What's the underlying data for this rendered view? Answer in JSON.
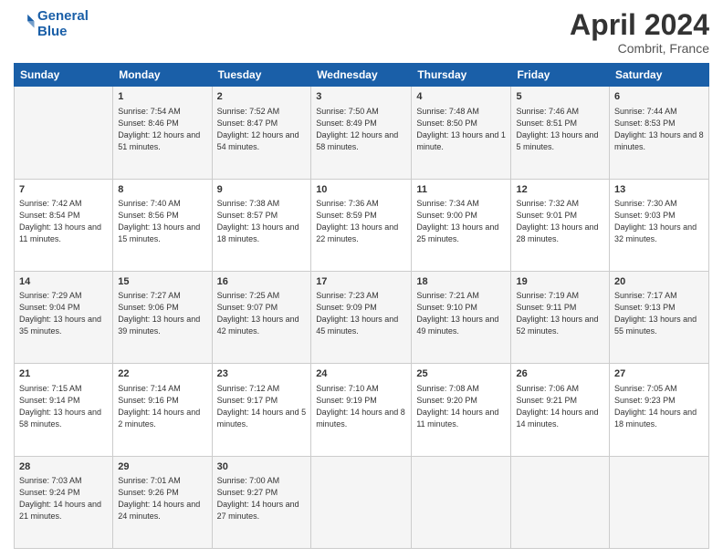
{
  "header": {
    "logo_line1": "General",
    "logo_line2": "Blue",
    "month": "April 2024",
    "location": "Combrit, France"
  },
  "days_of_week": [
    "Sunday",
    "Monday",
    "Tuesday",
    "Wednesday",
    "Thursday",
    "Friday",
    "Saturday"
  ],
  "weeks": [
    [
      {
        "day": "",
        "sunrise": "",
        "sunset": "",
        "daylight": ""
      },
      {
        "day": "1",
        "sunrise": "Sunrise: 7:54 AM",
        "sunset": "Sunset: 8:46 PM",
        "daylight": "Daylight: 12 hours and 51 minutes."
      },
      {
        "day": "2",
        "sunrise": "Sunrise: 7:52 AM",
        "sunset": "Sunset: 8:47 PM",
        "daylight": "Daylight: 12 hours and 54 minutes."
      },
      {
        "day": "3",
        "sunrise": "Sunrise: 7:50 AM",
        "sunset": "Sunset: 8:49 PM",
        "daylight": "Daylight: 12 hours and 58 minutes."
      },
      {
        "day": "4",
        "sunrise": "Sunrise: 7:48 AM",
        "sunset": "Sunset: 8:50 PM",
        "daylight": "Daylight: 13 hours and 1 minute."
      },
      {
        "day": "5",
        "sunrise": "Sunrise: 7:46 AM",
        "sunset": "Sunset: 8:51 PM",
        "daylight": "Daylight: 13 hours and 5 minutes."
      },
      {
        "day": "6",
        "sunrise": "Sunrise: 7:44 AM",
        "sunset": "Sunset: 8:53 PM",
        "daylight": "Daylight: 13 hours and 8 minutes."
      }
    ],
    [
      {
        "day": "7",
        "sunrise": "Sunrise: 7:42 AM",
        "sunset": "Sunset: 8:54 PM",
        "daylight": "Daylight: 13 hours and 11 minutes."
      },
      {
        "day": "8",
        "sunrise": "Sunrise: 7:40 AM",
        "sunset": "Sunset: 8:56 PM",
        "daylight": "Daylight: 13 hours and 15 minutes."
      },
      {
        "day": "9",
        "sunrise": "Sunrise: 7:38 AM",
        "sunset": "Sunset: 8:57 PM",
        "daylight": "Daylight: 13 hours and 18 minutes."
      },
      {
        "day": "10",
        "sunrise": "Sunrise: 7:36 AM",
        "sunset": "Sunset: 8:59 PM",
        "daylight": "Daylight: 13 hours and 22 minutes."
      },
      {
        "day": "11",
        "sunrise": "Sunrise: 7:34 AM",
        "sunset": "Sunset: 9:00 PM",
        "daylight": "Daylight: 13 hours and 25 minutes."
      },
      {
        "day": "12",
        "sunrise": "Sunrise: 7:32 AM",
        "sunset": "Sunset: 9:01 PM",
        "daylight": "Daylight: 13 hours and 28 minutes."
      },
      {
        "day": "13",
        "sunrise": "Sunrise: 7:30 AM",
        "sunset": "Sunset: 9:03 PM",
        "daylight": "Daylight: 13 hours and 32 minutes."
      }
    ],
    [
      {
        "day": "14",
        "sunrise": "Sunrise: 7:29 AM",
        "sunset": "Sunset: 9:04 PM",
        "daylight": "Daylight: 13 hours and 35 minutes."
      },
      {
        "day": "15",
        "sunrise": "Sunrise: 7:27 AM",
        "sunset": "Sunset: 9:06 PM",
        "daylight": "Daylight: 13 hours and 39 minutes."
      },
      {
        "day": "16",
        "sunrise": "Sunrise: 7:25 AM",
        "sunset": "Sunset: 9:07 PM",
        "daylight": "Daylight: 13 hours and 42 minutes."
      },
      {
        "day": "17",
        "sunrise": "Sunrise: 7:23 AM",
        "sunset": "Sunset: 9:09 PM",
        "daylight": "Daylight: 13 hours and 45 minutes."
      },
      {
        "day": "18",
        "sunrise": "Sunrise: 7:21 AM",
        "sunset": "Sunset: 9:10 PM",
        "daylight": "Daylight: 13 hours and 49 minutes."
      },
      {
        "day": "19",
        "sunrise": "Sunrise: 7:19 AM",
        "sunset": "Sunset: 9:11 PM",
        "daylight": "Daylight: 13 hours and 52 minutes."
      },
      {
        "day": "20",
        "sunrise": "Sunrise: 7:17 AM",
        "sunset": "Sunset: 9:13 PM",
        "daylight": "Daylight: 13 hours and 55 minutes."
      }
    ],
    [
      {
        "day": "21",
        "sunrise": "Sunrise: 7:15 AM",
        "sunset": "Sunset: 9:14 PM",
        "daylight": "Daylight: 13 hours and 58 minutes."
      },
      {
        "day": "22",
        "sunrise": "Sunrise: 7:14 AM",
        "sunset": "Sunset: 9:16 PM",
        "daylight": "Daylight: 14 hours and 2 minutes."
      },
      {
        "day": "23",
        "sunrise": "Sunrise: 7:12 AM",
        "sunset": "Sunset: 9:17 PM",
        "daylight": "Daylight: 14 hours and 5 minutes."
      },
      {
        "day": "24",
        "sunrise": "Sunrise: 7:10 AM",
        "sunset": "Sunset: 9:19 PM",
        "daylight": "Daylight: 14 hours and 8 minutes."
      },
      {
        "day": "25",
        "sunrise": "Sunrise: 7:08 AM",
        "sunset": "Sunset: 9:20 PM",
        "daylight": "Daylight: 14 hours and 11 minutes."
      },
      {
        "day": "26",
        "sunrise": "Sunrise: 7:06 AM",
        "sunset": "Sunset: 9:21 PM",
        "daylight": "Daylight: 14 hours and 14 minutes."
      },
      {
        "day": "27",
        "sunrise": "Sunrise: 7:05 AM",
        "sunset": "Sunset: 9:23 PM",
        "daylight": "Daylight: 14 hours and 18 minutes."
      }
    ],
    [
      {
        "day": "28",
        "sunrise": "Sunrise: 7:03 AM",
        "sunset": "Sunset: 9:24 PM",
        "daylight": "Daylight: 14 hours and 21 minutes."
      },
      {
        "day": "29",
        "sunrise": "Sunrise: 7:01 AM",
        "sunset": "Sunset: 9:26 PM",
        "daylight": "Daylight: 14 hours and 24 minutes."
      },
      {
        "day": "30",
        "sunrise": "Sunrise: 7:00 AM",
        "sunset": "Sunset: 9:27 PM",
        "daylight": "Daylight: 14 hours and 27 minutes."
      },
      {
        "day": "",
        "sunrise": "",
        "sunset": "",
        "daylight": ""
      },
      {
        "day": "",
        "sunrise": "",
        "sunset": "",
        "daylight": ""
      },
      {
        "day": "",
        "sunrise": "",
        "sunset": "",
        "daylight": ""
      },
      {
        "day": "",
        "sunrise": "",
        "sunset": "",
        "daylight": ""
      }
    ]
  ]
}
